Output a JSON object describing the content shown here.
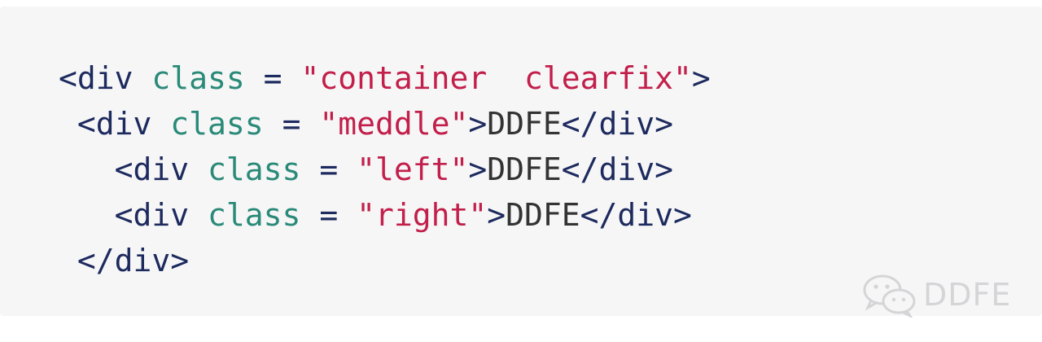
{
  "code": {
    "lines": [
      {
        "indent": "",
        "tokens": [
          {
            "type": "punct",
            "text": "<div"
          },
          {
            "type": "space",
            "text": " "
          },
          {
            "type": "attr",
            "text": "class"
          },
          {
            "type": "op",
            "text": " = "
          },
          {
            "type": "str",
            "text": "\"container  clearfix\""
          },
          {
            "type": "punct",
            "text": ">"
          }
        ]
      },
      {
        "indent": " ",
        "tokens": [
          {
            "type": "punct",
            "text": "<div"
          },
          {
            "type": "space",
            "text": " "
          },
          {
            "type": "attr",
            "text": "class"
          },
          {
            "type": "op",
            "text": " = "
          },
          {
            "type": "str",
            "text": "\"meddle\""
          },
          {
            "type": "punct",
            "text": ">"
          },
          {
            "type": "text",
            "text": "DDFE"
          },
          {
            "type": "punct",
            "text": "</div>"
          }
        ]
      },
      {
        "indent": "   ",
        "tokens": [
          {
            "type": "punct",
            "text": "<div"
          },
          {
            "type": "space",
            "text": " "
          },
          {
            "type": "attr",
            "text": "class"
          },
          {
            "type": "op",
            "text": " = "
          },
          {
            "type": "str",
            "text": "\"left\""
          },
          {
            "type": "punct",
            "text": ">"
          },
          {
            "type": "text",
            "text": "DDFE"
          },
          {
            "type": "punct",
            "text": "</div>"
          }
        ]
      },
      {
        "indent": "   ",
        "tokens": [
          {
            "type": "punct",
            "text": "<div"
          },
          {
            "type": "space",
            "text": " "
          },
          {
            "type": "attr",
            "text": "class"
          },
          {
            "type": "op",
            "text": " = "
          },
          {
            "type": "str",
            "text": "\"right\""
          },
          {
            "type": "punct",
            "text": ">"
          },
          {
            "type": "text",
            "text": "DDFE"
          },
          {
            "type": "punct",
            "text": "</div>"
          }
        ]
      },
      {
        "indent": " ",
        "tokens": [
          {
            "type": "punct",
            "text": "</div>"
          }
        ]
      }
    ]
  },
  "watermark": {
    "icon": "wechat-icon",
    "text": "DDFE"
  },
  "colors": {
    "background": "#f6f6f7",
    "tag": "#1d2a5e",
    "attribute": "#2a8a78",
    "string": "#c21f4a",
    "text": "#333333",
    "watermark": "#d5d5d7"
  }
}
